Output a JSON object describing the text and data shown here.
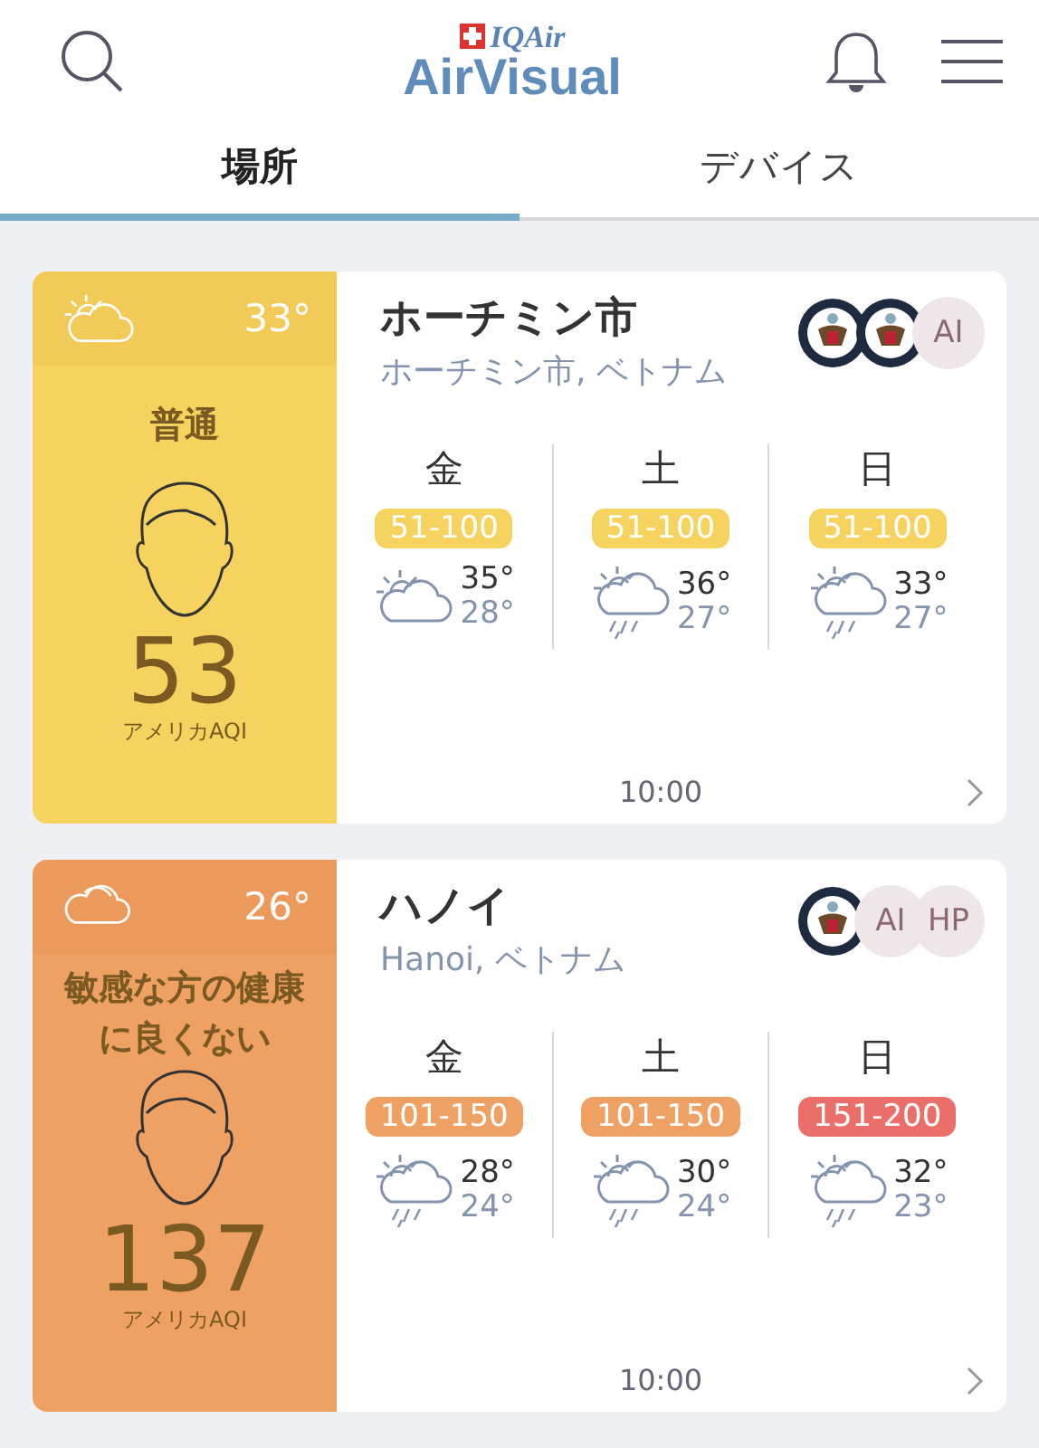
{
  "header": {
    "brand": "IQAir",
    "title": "AirVisual"
  },
  "tabs": [
    {
      "label": "場所",
      "selected": true
    },
    {
      "label": "デバイス",
      "selected": false
    }
  ],
  "cards": [
    {
      "color": "#f5d35e",
      "kind": "partly-cloudy",
      "temperature": "33°",
      "status": "普通",
      "aqi": "53",
      "aqi_label": "アメリカAQI",
      "city": "ホーチミン市",
      "location": "ホーチミン市, ベトナム",
      "sources": [
        {
          "kind": "seal"
        },
        {
          "kind": "seal"
        },
        {
          "kind": "text",
          "label": "AI"
        }
      ],
      "forecast": [
        {
          "day": "金",
          "range": "51-100",
          "color": "#f5d35e",
          "kind": "partly-cloudy",
          "high": "35°",
          "low": "28°"
        },
        {
          "day": "土",
          "range": "51-100",
          "color": "#f5d35e",
          "kind": "rain",
          "high": "36°",
          "low": "27°"
        },
        {
          "day": "日",
          "range": "51-100",
          "color": "#f5d35e",
          "kind": "rain",
          "high": "33°",
          "low": "27°"
        }
      ],
      "time": "10:00"
    },
    {
      "color": "#efa063",
      "kind": "cloud",
      "temperature": "26°",
      "status": "敏感な方の健康に良くない",
      "aqi": "137",
      "aqi_label": "アメリカAQI",
      "city": "ハノイ",
      "location": "Hanoi, ベトナム",
      "sources": [
        {
          "kind": "seal"
        },
        {
          "kind": "text",
          "label": "AI"
        },
        {
          "kind": "text",
          "label": "HP"
        }
      ],
      "forecast": [
        {
          "day": "金",
          "range": "101-150",
          "color": "#efa063",
          "kind": "rain",
          "high": "28°",
          "low": "24°"
        },
        {
          "day": "土",
          "range": "101-150",
          "color": "#efa063",
          "kind": "rain",
          "high": "30°",
          "low": "24°"
        },
        {
          "day": "日",
          "range": "151-200",
          "color": "#ea6f6a",
          "kind": "rain",
          "high": "32°",
          "low": "23°"
        }
      ],
      "time": "10:00"
    }
  ]
}
